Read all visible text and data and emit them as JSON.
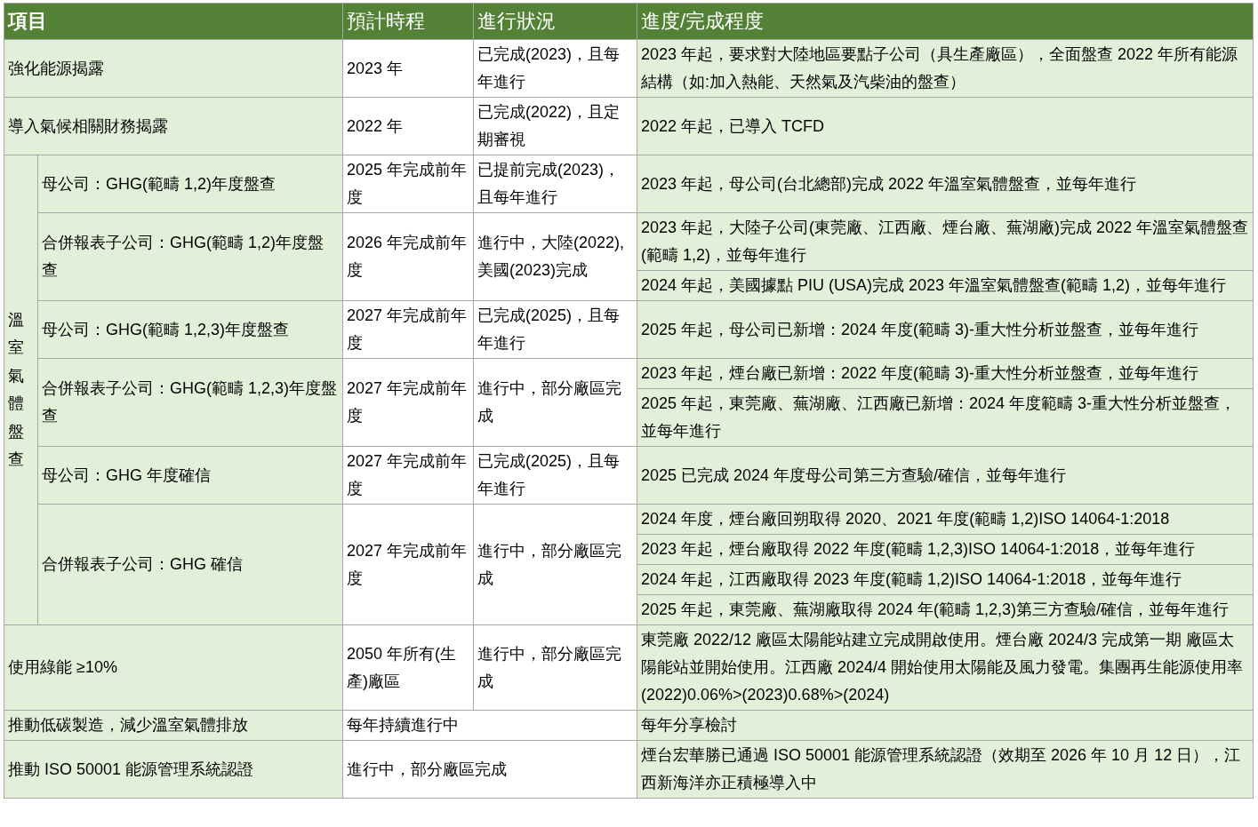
{
  "table": {
    "columns": [
      "項目",
      "預計時程",
      "進行狀況",
      "進度/完成程度"
    ],
    "rows": [
      {
        "kind": "item",
        "item": "強化能源揭露",
        "schedule": "2023 年",
        "status": "已完成(2023)，且每年進行",
        "progress": [
          "2023 年起，要求對大陸地區要點子公司（具生產廠區），全面盤查 2022 年所有能源結構（如:加入熱能、天然氣及汽柴油的盤查）"
        ]
      },
      {
        "kind": "item",
        "item": "導入氣候相關財務揭露",
        "schedule": "2022 年",
        "status": "已完成(2022)，且定期審視",
        "progress": [
          "2022 年起，已導入 TCFD"
        ]
      },
      {
        "kind": "group",
        "label": "溫室氣體盤查",
        "children": [
          {
            "item": "母公司：GHG(範疇 1,2)年度盤查",
            "schedule": "2025 年完成前年度",
            "status": "已提前完成(2023)，且每年進行",
            "progress": [
              "2023 年起，母公司(台北總部)完成 2022 年溫室氣體盤查，並每年進行"
            ]
          },
          {
            "item": "合併報表子公司：GHG(範疇 1,2)年度盤查",
            "schedule": "2026 年完成前年度",
            "status": "進行中，大陸(2022),美國(2023)完成",
            "progress": [
              "2023 年起，大陸子公司(東莞廠、江西廠、煙台廠、蕪湖廠)完成 2022 年溫室氣體盤查(範疇 1,2)，並每年進行",
              "2024 年起，美國據點 PIU (USA)完成 2023 年溫室氣體盤查(範疇 1,2)，並每年進行"
            ]
          },
          {
            "item": "母公司：GHG(範疇 1,2,3)年度盤查",
            "schedule": "2027 年完成前年度",
            "status": "已完成(2025)，且每年進行",
            "progress": [
              "2025 年起，母公司已新增：2024 年度(範疇 3)-重大性分析並盤查，並每年進行"
            ]
          },
          {
            "item": "合併報表子公司：GHG(範疇 1,2,3)年度盤查",
            "schedule": "2027 年完成前年度",
            "status": "進行中，部分廠區完成",
            "progress": [
              "2023 年起，煙台廠已新增：2022 年度(範疇 3)-重大性分析並盤查，並每年進行",
              "2025 年起，東莞廠、蕪湖廠、江西廠已新增：2024 年度範疇 3-重大性分析並盤查，並每年進行"
            ]
          },
          {
            "item": "母公司：GHG 年度確信",
            "schedule": "2027 年完成前年度",
            "status": "已完成(2025)，且每年進行",
            "progress": [
              "2025 已完成 2024 年度母公司第三方查驗/確信，並每年進行"
            ]
          },
          {
            "item": "合併報表子公司：GHG 確信",
            "schedule": "2027 年完成前年度",
            "status": "進行中，部分廠區完成",
            "progress": [
              "2024 年度，煙台廠回朔取得 2020、2021 年度(範疇 1,2)ISO 14064-1:2018",
              "2023 年起，煙台廠取得 2022 年度(範疇 1,2,3)ISO 14064-1:2018，並每年進行",
              "2024 年起，江西廠取得 2023 年度(範疇 1,2)ISO 14064-1:2018，並每年進行",
              "2025 年起，東莞廠、蕪湖廠取得 2024 年(範疇 1,2,3)第三方查驗/確信，並每年進行"
            ]
          }
        ]
      },
      {
        "kind": "item",
        "item": "使用綠能 ≥10%",
        "schedule": "2050 年所有(生產)廠區",
        "status": "進行中，部分廠區完成",
        "progress": [
          "東莞廠 2022/12 廠區太陽能站建立完成開啟使用。煙台廠 2024/3 完成第一期 廠區太陽能站並開始使用。江西廠 2024/4 開始使用太陽能及風力發電。集團再生能源使用率(2022)0.06%>(2023)0.68%>(2024)"
        ]
      },
      {
        "kind": "merged",
        "item": "推動低碳製造，減少溫室氣體排放",
        "plan": "每年持續進行中",
        "progress": [
          "每年分享檢討"
        ]
      },
      {
        "kind": "merged",
        "item": "推動 ISO 50001 能源管理系統認證",
        "plan": "進行中，部分廠區完成",
        "progress": [
          "煙台宏華勝已通過 ISO 50001 能源管理系統認證（效期至 2026 年 10 月 12 日），江西新海洋亦正積極導入中"
        ]
      }
    ]
  }
}
